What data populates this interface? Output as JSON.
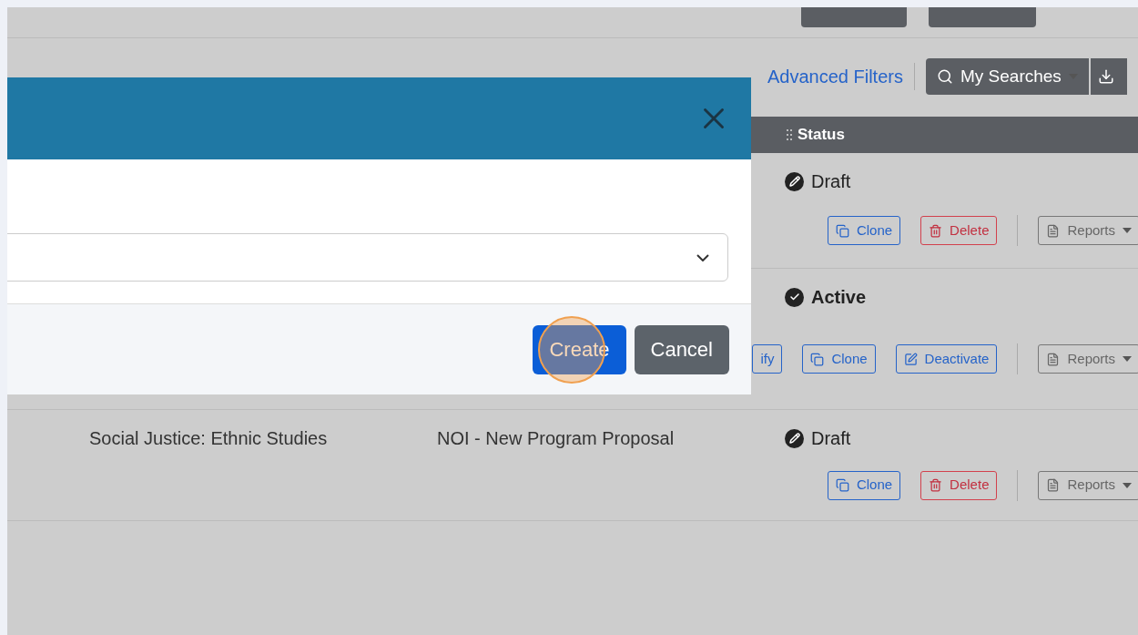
{
  "advanced_filters": "Advanced Filters",
  "my_searches": "My Searches",
  "table": {
    "columns": [
      {
        "label": "Status"
      }
    ],
    "rows": [
      {
        "cells": [],
        "status": {
          "kind": "draft",
          "label": "Draft"
        },
        "actions": [
          {
            "kind": "clone",
            "label": "Clone"
          },
          {
            "kind": "delete",
            "label": "Delete"
          },
          {
            "kind": "reports",
            "label": "Reports"
          }
        ]
      },
      {
        "cells": [],
        "status": {
          "kind": "active",
          "label": "Active"
        },
        "actions": [
          {
            "kind": "modify",
            "label": "ify"
          },
          {
            "kind": "clone",
            "label": "Clone"
          },
          {
            "kind": "deactivate",
            "label": "Deactivate"
          },
          {
            "kind": "reports",
            "label": "Reports"
          }
        ]
      },
      {
        "cells": [
          "Social Justice: Ethnic Studies",
          "NOI - New Program Proposal"
        ],
        "status": {
          "kind": "draft",
          "label": "Draft"
        },
        "actions": [
          {
            "kind": "clone",
            "label": "Clone"
          },
          {
            "kind": "delete",
            "label": "Delete"
          },
          {
            "kind": "reports",
            "label": "Reports"
          }
        ]
      }
    ]
  },
  "modal": {
    "buttons": [
      {
        "kind": "primary",
        "label": "Create",
        "highlighted": true
      },
      {
        "kind": "secondary",
        "label": "Cancel",
        "highlighted": false
      }
    ]
  }
}
